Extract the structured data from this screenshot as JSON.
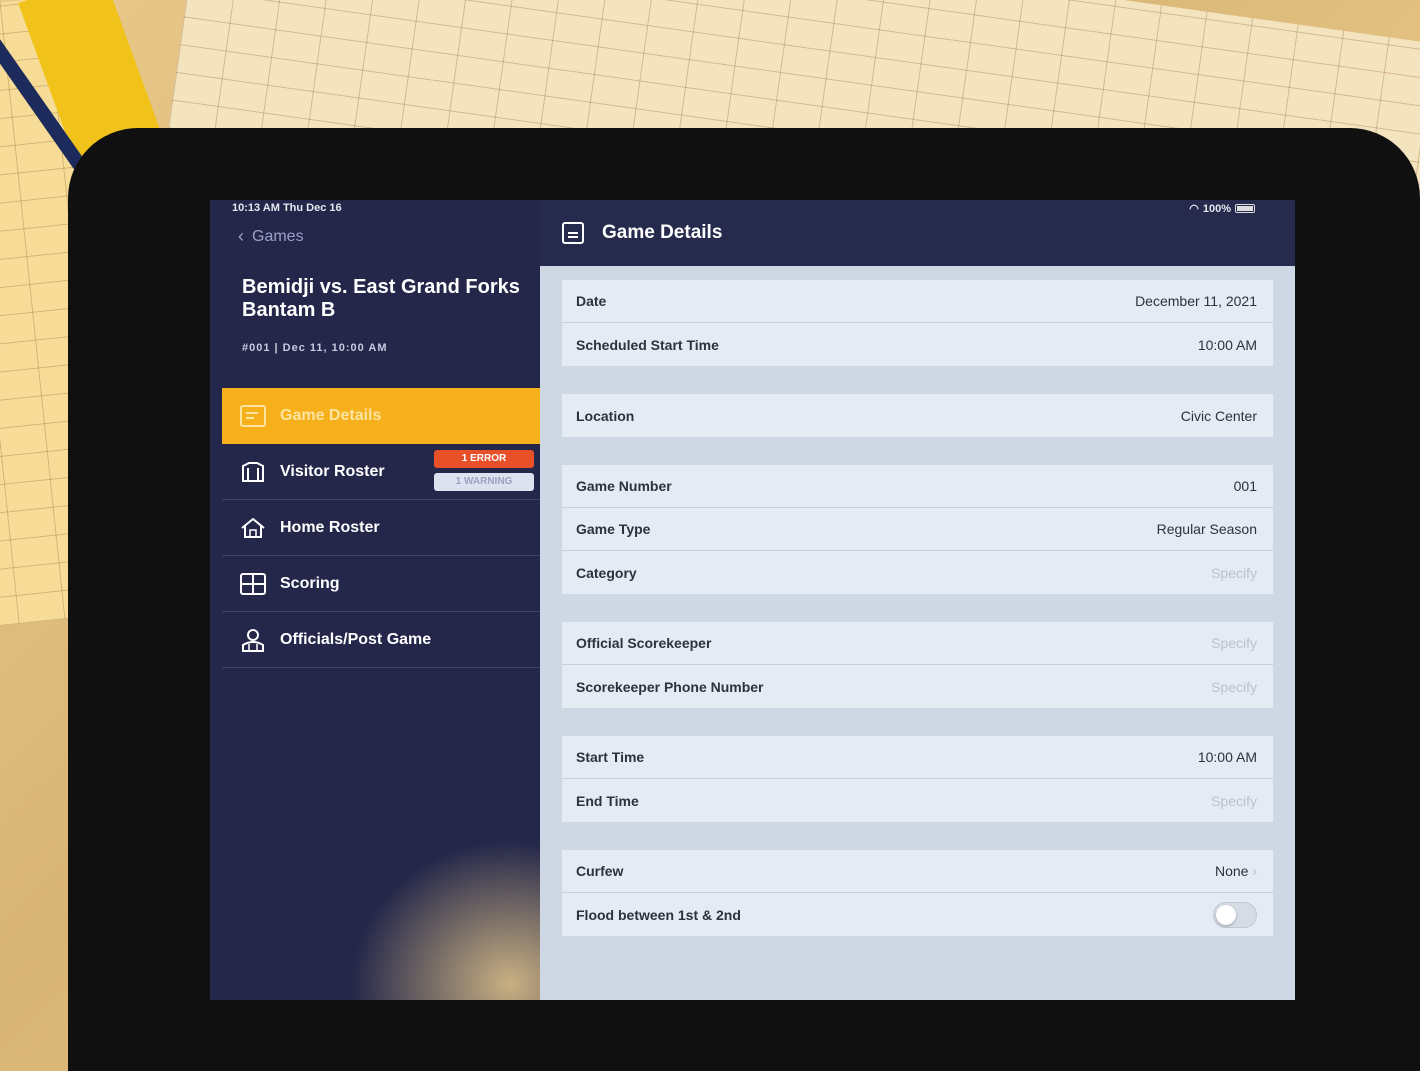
{
  "status_bar": {
    "time": "10:13 AM   Thu Dec 16",
    "battery": "100%"
  },
  "sidebar": {
    "back_label": "Games",
    "title": "Bemidji vs. East Grand Forks Bantam B",
    "meta": "#001   |   Dec 11, 10:00 AM",
    "items": [
      {
        "label": "Game Details",
        "icon": "list-icon",
        "active": true
      },
      {
        "label": "Visitor Roster",
        "icon": "jersey-icon",
        "badges": {
          "error": "1 ERROR",
          "warning": "1 WARNING"
        }
      },
      {
        "label": "Home Roster",
        "icon": "home-icon"
      },
      {
        "label": "Scoring",
        "icon": "scoreboard-icon"
      },
      {
        "label": "Officials/Post Game",
        "icon": "referee-icon"
      }
    ]
  },
  "detail": {
    "title": "Game Details",
    "groups": [
      {
        "rows": [
          {
            "label": "Date",
            "value": "December 11, 2021"
          },
          {
            "label": "Scheduled Start Time",
            "value": "10:00 AM"
          }
        ]
      },
      {
        "rows": [
          {
            "label": "Location",
            "value": "Civic Center"
          }
        ]
      },
      {
        "rows": [
          {
            "label": "Game Number",
            "value": "001"
          },
          {
            "label": "Game Type",
            "value": "Regular Season"
          },
          {
            "label": "Category",
            "value": "Specify"
          }
        ]
      },
      {
        "rows": [
          {
            "label": "Official Scorekeeper",
            "value": "Specify"
          },
          {
            "label": "Scorekeeper Phone Number",
            "value": "Specify"
          }
        ]
      },
      {
        "rows": [
          {
            "label": "Start Time",
            "value": "10:00 AM"
          },
          {
            "label": "End Time",
            "value": "Specify"
          }
        ]
      },
      {
        "rows": [
          {
            "label": "Curfew",
            "value": "None"
          },
          {
            "label": "Flood between 1st & 2nd",
            "value": ""
          }
        ]
      }
    ]
  }
}
